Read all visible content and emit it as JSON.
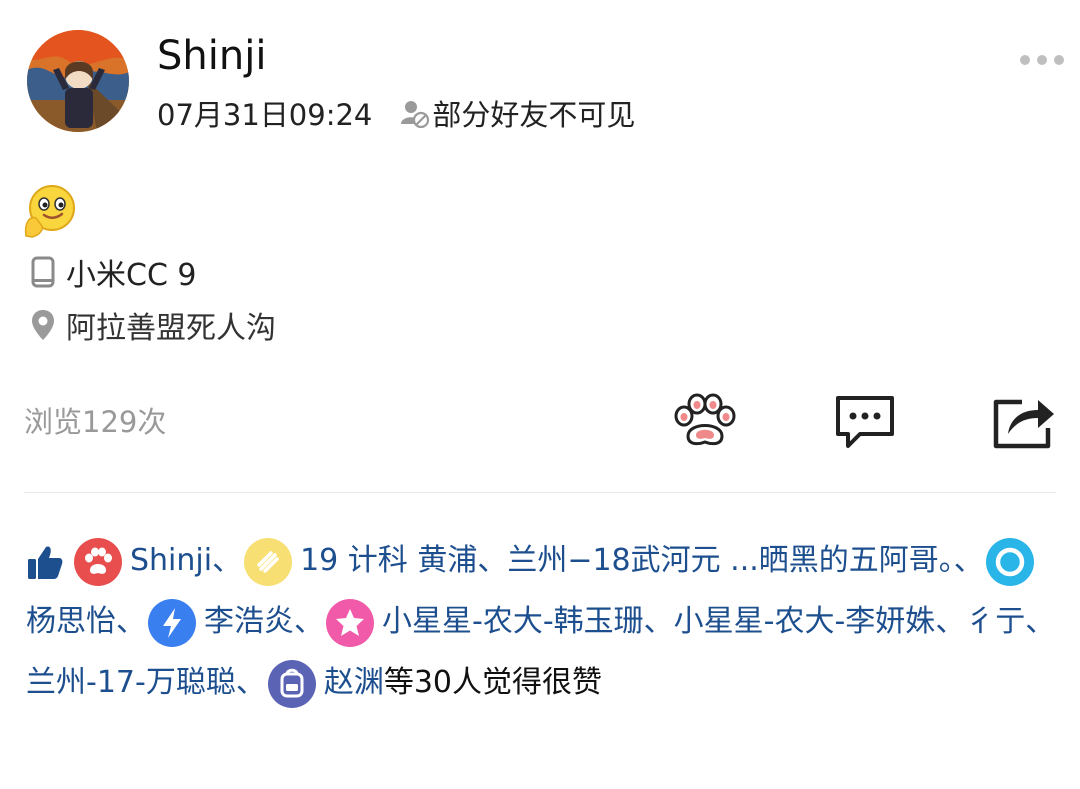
{
  "post": {
    "username": "Shinji",
    "time": "07月31日09:24",
    "visibility": "部分好友不可见",
    "device": "小米CC 9",
    "location": "阿拉善盟死人沟",
    "views": "浏览129次"
  },
  "icons": {
    "more": "more-dots-icon",
    "visibility": "person-blocked-icon",
    "emoji": "thinking-smile-emoji",
    "device": "phone-icon",
    "location": "location-pin-icon",
    "paw": "paw-icon",
    "comment": "comment-icon",
    "share": "share-icon",
    "like": "thumbs-up-icon"
  },
  "colors": {
    "link": "#1d4f8f",
    "secondary": "#999999",
    "badge_red": "#e84e4e",
    "badge_yellow": "#f8df73",
    "badge_cyan": "#29b5e8",
    "badge_blue": "#3a7ff0",
    "badge_pink": "#f05aa8",
    "badge_indigo": "#5b63b5"
  },
  "likes": {
    "users": [
      {
        "name": "Shinji",
        "badge": "paw"
      },
      {
        "name": "19 计科  黄浦、兰州−18武河元 ...晒黑的五阿哥。",
        "badge": "rocket"
      },
      {
        "name": "杨思怡",
        "badge": "ring"
      },
      {
        "name": "李浩炎",
        "badge": "bolt"
      },
      {
        "name": "小星星-农大-韩玉珊",
        "badge": "star"
      },
      {
        "name": "小星星-农大-李妍姝",
        "badge": ""
      },
      {
        "name": "彳亍、兰州-17-万聪聪",
        "badge": ""
      },
      {
        "name": "赵渊",
        "badge": "backpack"
      }
    ],
    "separator": "、",
    "tail": "等30人觉得很赞"
  }
}
